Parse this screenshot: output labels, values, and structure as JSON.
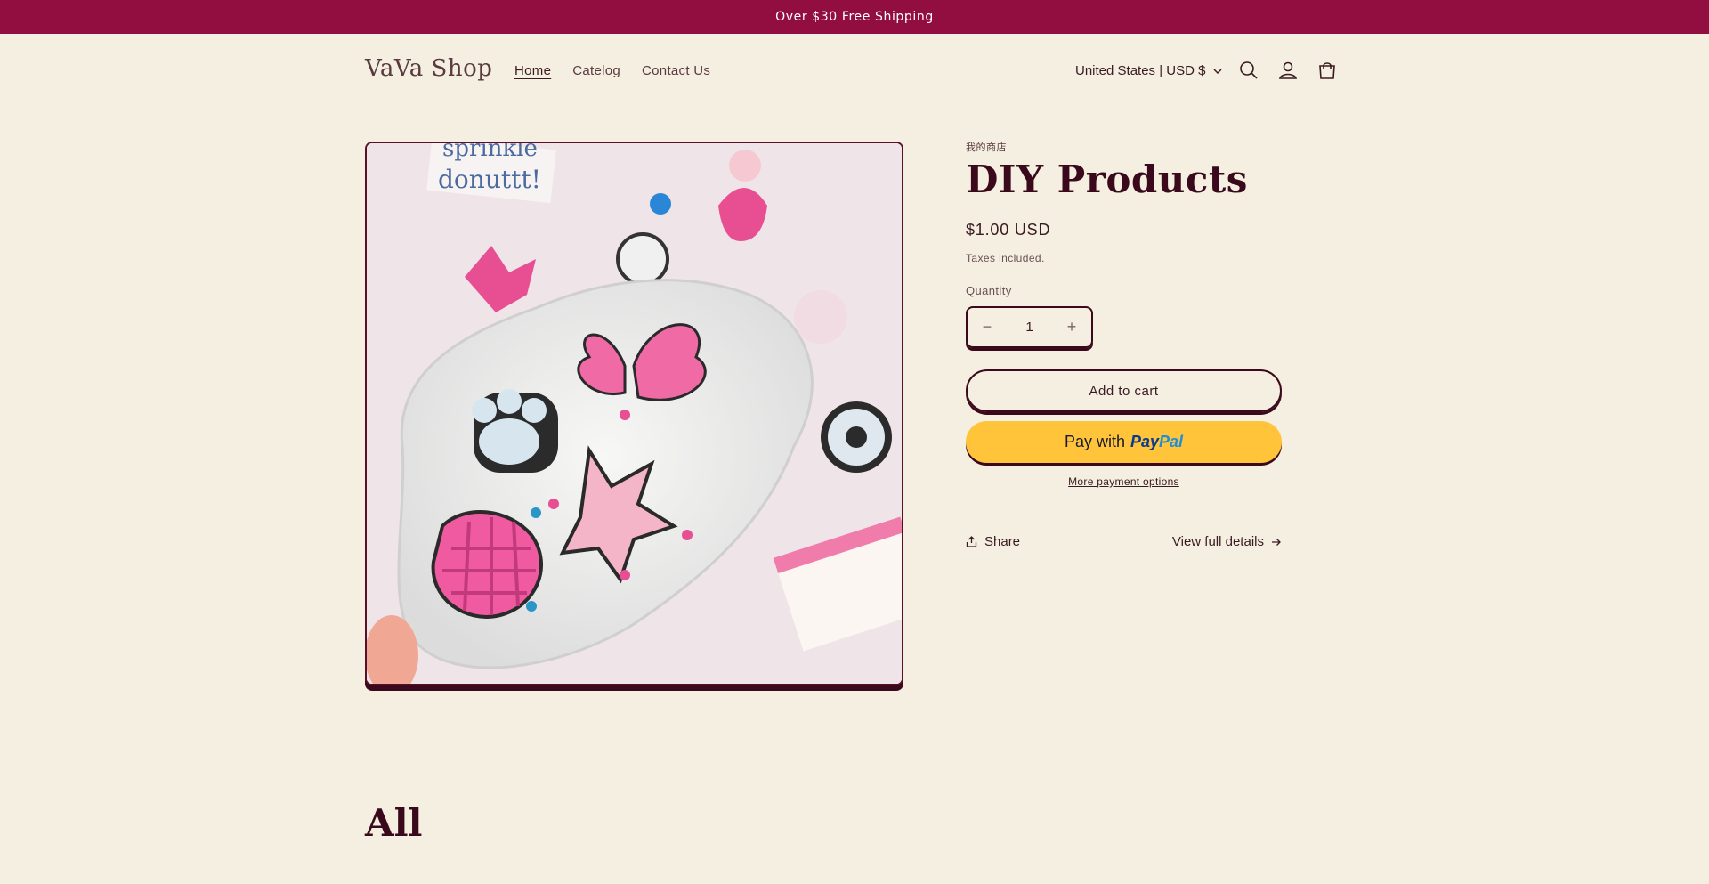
{
  "announcement": "Over $30 Free Shipping",
  "header": {
    "logo": "VaVa Shop",
    "nav": [
      "Home",
      "Catelog",
      "Contact Us"
    ],
    "locale": "United States | USD $",
    "icons": [
      "search-icon",
      "account-icon",
      "cart-icon"
    ]
  },
  "product": {
    "vendor": "我的商店",
    "title": "DIY Products",
    "price": "$1.00 USD",
    "tax_note": "Taxes included.",
    "quantity_label": "Quantity",
    "quantity": "1",
    "minus": "−",
    "plus": "+",
    "add_to_cart": "Add to cart",
    "paypal_prefix": "Pay with",
    "paypal_brand_a": "Pay",
    "paypal_brand_b": "Pal",
    "more_payment": "More payment options",
    "share": "Share",
    "view_details": "View full details"
  },
  "image_text": {
    "sprinkle": "sprinkle",
    "donut": "donuttt!"
  },
  "section_title": "All",
  "colors": {
    "background": "#f4efe0",
    "announcement": "#920e40",
    "accent": "#3a0a1c",
    "paypal": "#ffc439"
  }
}
